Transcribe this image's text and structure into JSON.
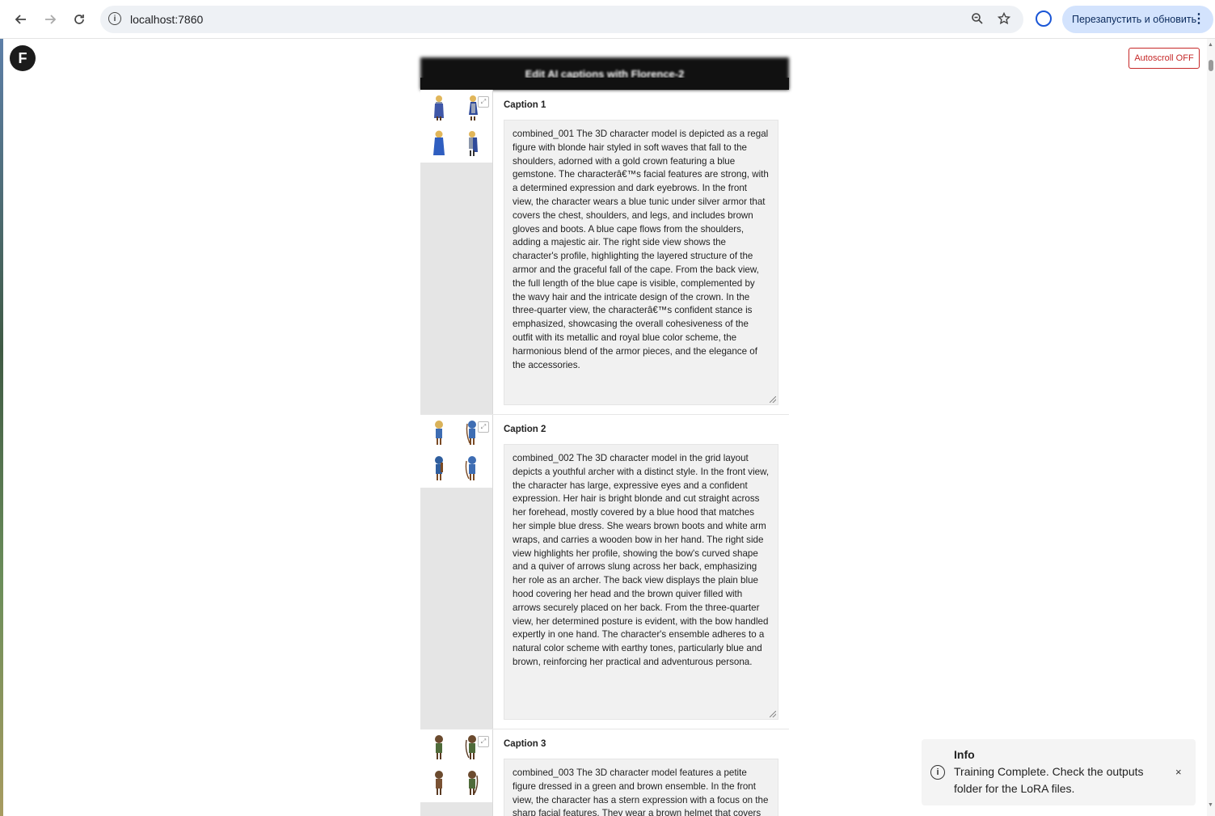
{
  "browser": {
    "url": "localhost:7860",
    "relaunch_label": "Перезапустить и обновить",
    "icons": {
      "back": "back-arrow-icon",
      "forward": "forward-arrow-icon",
      "reload": "reload-icon",
      "zoom": "zoom-icon",
      "bookmark": "star-icon",
      "profile": "profile-icon",
      "menu": "kebab-menu-icon"
    }
  },
  "page": {
    "logo_letter": "F",
    "autoscroll_label": "Autoscroll OFF",
    "header_title": "Edit AI captions with Florence-2"
  },
  "captions": [
    {
      "label": "Caption 1",
      "text": "combined_001 The 3D character model is depicted as a regal figure with blonde hair styled in soft waves that fall to the shoulders, adorned with a gold crown featuring a blue gemstone. The characterâ€™s facial features are strong, with a determined expression and dark eyebrows. In the front view, the character wears a blue tunic under silver armor that covers the chest, shoulders, and legs, and includes brown gloves and boots. A blue cape flows from the shoulders, adding a majestic air. The right side view shows the character's profile, highlighting the layered structure of the armor and the graceful fall of the cape. From the back view, the full length of the blue cape is visible, complemented by the wavy hair and the intricate design of the crown. In the three-quarter view, the characterâ€™s confident stance is emphasized, showcasing the overall cohesiveness of the outfit with its metallic and royal blue color scheme, the harmonious blend of the armor pieces, and the elegance of the accessories."
    },
    {
      "label": "Caption 2",
      "text": "combined_002 The 3D character model in the grid layout depicts a youthful archer with a distinct style. In the front view, the character has large, expressive eyes and a confident expression. Her hair is bright blonde and cut straight across her forehead, mostly covered by a blue hood that matches her simple blue dress. She wears brown boots and white arm wraps, and carries a wooden bow in her hand. The right side view highlights her profile, showing the bow's curved shape and a quiver of arrows slung across her back, emphasizing her role as an archer. The back view displays the plain blue hood covering her head and the brown quiver filled with arrows securely placed on her back. From the three-quarter view, her determined posture is evident, with the bow handled expertly in one hand. The character's ensemble adheres to a natural color scheme with earthy tones, particularly blue and brown, reinforcing her practical and adventurous persona."
    },
    {
      "label": "Caption 3",
      "text": "combined_003 The 3D character model features a petite figure dressed in a green and brown ensemble. In the front view, the character has a stern expression with a focus on the sharp facial features. They wear a brown helmet that covers the head with"
    }
  ],
  "toast": {
    "title": "Info",
    "message": "Training Complete. Check the outputs folder for the LoRA files.",
    "close": "×"
  }
}
